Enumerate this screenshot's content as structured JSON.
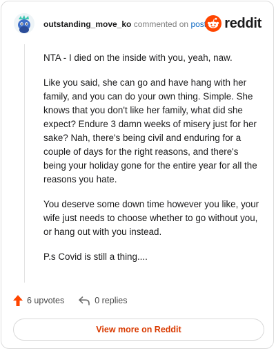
{
  "header": {
    "username": "outstanding_move_ko",
    "action_text": "commented on",
    "post_link": "post",
    "brand": "reddit"
  },
  "comment": {
    "paragraphs": [
      "NTA - I died on the inside with you, yeah, naw.",
      "Like you said, she can go and have hang with her family, and you can do your own thing. Simple. She knows that you don't like her family, what did she expect? Endure 3 damn weeks of misery just for her sake? Nah, there's being civil and enduring for a couple of days for the right reasons, and there's being your holiday gone for the entire year for all the reasons you hate.",
      "You deserve some down time however you like, your wife just needs to choose whether to go without you, or hang out with you instead.",
      "P.s Covid is still a thing...."
    ]
  },
  "actions": {
    "upvotes": "6 upvotes",
    "replies": "0 replies"
  },
  "footer": {
    "view_more": "View more on Reddit"
  },
  "colors": {
    "brand_orange": "#ff4500",
    "link_blue": "#0a66c2",
    "button_text": "#d93a00"
  },
  "icons": [
    "avatar",
    "reddit-logo-icon",
    "upvote-arrow-icon",
    "reply-arrow-icon"
  ]
}
